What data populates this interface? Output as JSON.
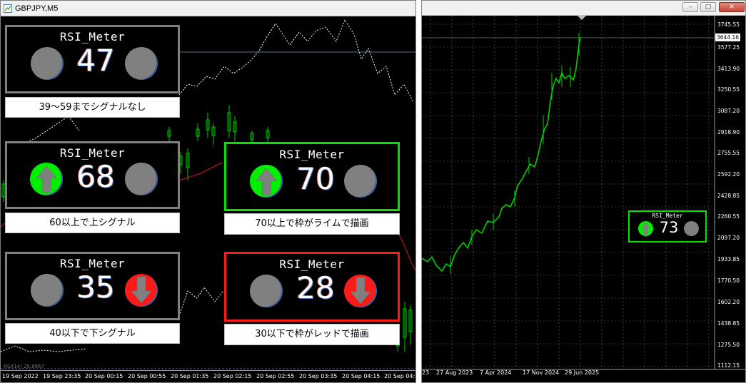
{
  "left_window": {
    "title": "GBPJPY,M5",
    "indicator_label": "RSI(14) 25.8967",
    "time_axis": [
      "19 Sep 2022",
      "19 Sep 23:35",
      "20 Sep 00:15",
      "20 Sep 00:55",
      "20 Sep 01:35",
      "20 Sep 02:15",
      "20 Sep 02:55",
      "20 Sep 03:35",
      "20 Sep 04:15",
      "20 Sep 04:"
    ]
  },
  "meters": [
    {
      "title": "RSI_Meter",
      "value": "47",
      "caption": "39～59までシグナルなし",
      "frame": "gray",
      "left": "neutral",
      "right": "neutral"
    },
    {
      "title": "RSI_Meter",
      "value": "68",
      "caption": "60以上で上シグナル",
      "frame": "gray",
      "left": "up",
      "right": "neutral"
    },
    {
      "title": "RSI_Meter",
      "value": "70",
      "caption": "70以上で枠がライムで描画",
      "frame": "lime",
      "left": "up",
      "right": "neutral"
    },
    {
      "title": "RSI_Meter",
      "value": "35",
      "caption": "40以下で下シグナル",
      "frame": "gray",
      "left": "neutral",
      "right": "down"
    },
    {
      "title": "RSI_Meter",
      "value": "28",
      "caption": "30以下で枠がレッドで描画",
      "frame": "red",
      "left": "neutral",
      "right": "down"
    }
  ],
  "right_window": {
    "buttons": {
      "minimize": "–",
      "maximize": "□",
      "close": "✕"
    },
    "current_price": "3644.16",
    "price_axis": [
      "3745.55",
      "3577.25",
      "3413.90",
      "3250.55",
      "3087.20",
      "2918.90",
      "2755.55",
      "2592.20",
      "2428.85",
      "2260.55",
      "2097.20",
      "1933.85",
      "1770.50",
      "1602.20",
      "1438.85",
      "1275.50",
      "1112.15"
    ],
    "time_axis": [
      "23",
      "27 Aug 2023",
      "7 Apr 2024",
      "17 Nov 2024",
      "29 Jun 2025"
    ],
    "mini_meter": {
      "title": "RSI_Meter",
      "value": "73"
    }
  },
  "colors": {
    "lime": "#00e600",
    "red": "#ff1a1a",
    "neutral_gray": "#808080",
    "up_green": "#00ee00"
  },
  "icons": [
    "up-arrow-icon",
    "down-arrow-icon",
    "neutral-circle-icon",
    "chart-window-icon"
  ]
}
